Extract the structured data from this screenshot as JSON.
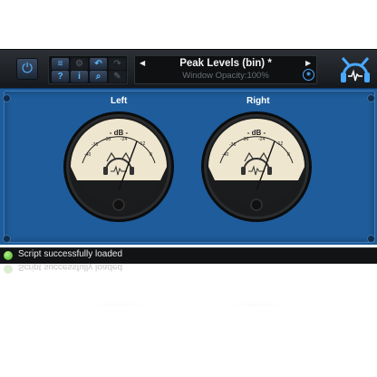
{
  "preset": {
    "name": "Peak Levels (bin) *",
    "subtitle": "Window Opacity:100%"
  },
  "toolbar": {
    "buttons": [
      {
        "name": "menu",
        "glyph": "≡",
        "active": true
      },
      {
        "name": "gear",
        "glyph": "⚙",
        "active": false
      },
      {
        "name": "undo",
        "glyph": "↶",
        "active": true
      },
      {
        "name": "redo",
        "glyph": "↷",
        "active": false
      },
      {
        "name": "help",
        "glyph": "?",
        "active": true
      },
      {
        "name": "info",
        "glyph": "i",
        "active": true
      },
      {
        "name": "zoom",
        "glyph": "⌕",
        "active": true
      },
      {
        "name": "edit",
        "glyph": "✎",
        "active": false
      }
    ]
  },
  "channels": {
    "left": "Left",
    "right": "Right"
  },
  "meter": {
    "unit": "- dB -",
    "ticks": [
      "-40",
      "-36",
      "-30",
      "-24",
      "-12",
      "0"
    ]
  },
  "status": {
    "text": "Script successfully loaded"
  },
  "colors": {
    "accent": "#4aa8ff",
    "panel": "#1e5c9b",
    "meterFace": "#efe6cf"
  },
  "icons": {
    "power": "power-icon",
    "logo": "cat-headphones-logo",
    "settings": "settings-icon",
    "status": "status-ok-icon"
  }
}
